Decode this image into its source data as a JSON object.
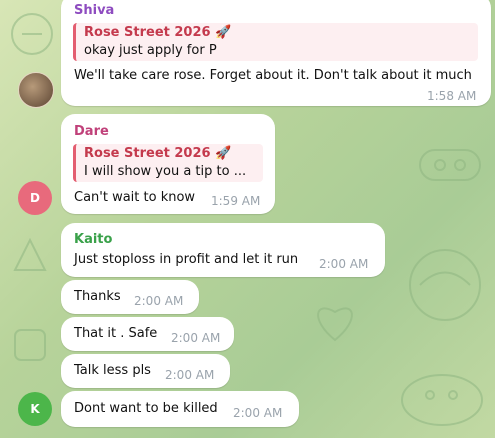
{
  "messages": [
    {
      "sender": "Shiva",
      "sender_color": "#8e4cc0",
      "reply_title": "Rose Street 2026 🚀",
      "reply_text": "okay just apply for P",
      "text": "We'll take care rose. Forget about it. Don't talk about it much",
      "time": "1:58 AM"
    },
    {
      "sender": "Dare",
      "sender_color": "#c0417a",
      "reply_title": "Rose Street 2026 🚀",
      "reply_text": "I will show you a tip to ...",
      "text": "Can't wait to know",
      "time": "1:59 AM",
      "avatar_letter": "D",
      "avatar_color": "#e86a7c"
    },
    {
      "sender": "Kaito",
      "sender_color": "#3aa14a",
      "text": "Just stoploss in profit and let it run",
      "time": "2:00 AM"
    },
    {
      "text": "Thanks",
      "time": "2:00 AM"
    },
    {
      "text": "That it . Safe",
      "time": "2:00 AM"
    },
    {
      "text": "Talk less pls",
      "time": "2:00 AM"
    },
    {
      "text": "Dont want to be killed",
      "time": "2:00 AM",
      "avatar_letter": "K",
      "avatar_color": "#4cb64a"
    }
  ]
}
